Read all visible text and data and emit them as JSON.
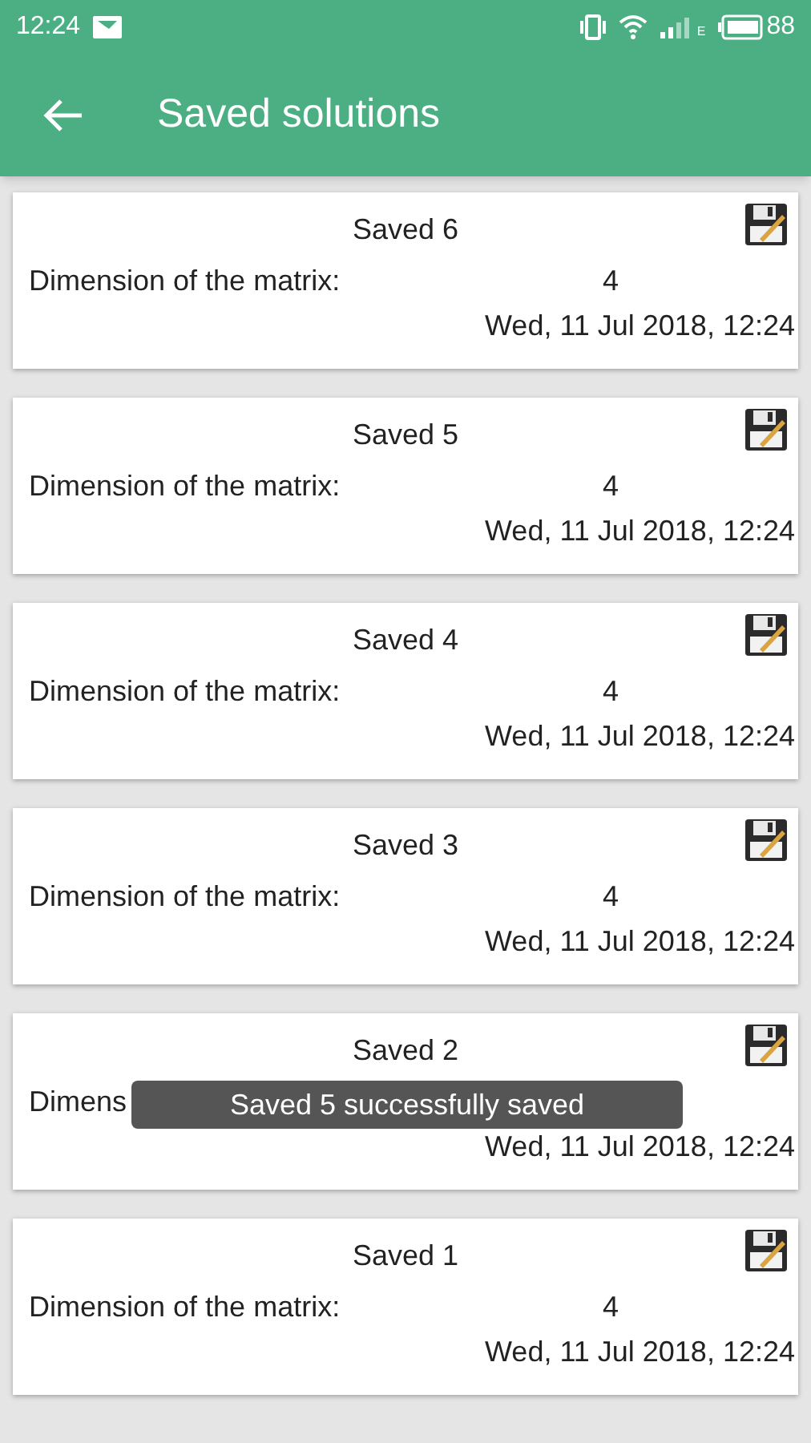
{
  "status_bar": {
    "time": "12:24",
    "network_type": "E",
    "battery": "88"
  },
  "app_bar": {
    "title": "Saved solutions"
  },
  "cards": [
    {
      "title": "Saved 6",
      "label": "Dimension of the matrix:",
      "value": "4",
      "date": "Wed, 11 Jul 2018, 12:24"
    },
    {
      "title": "Saved 5",
      "label": "Dimension of the matrix:",
      "value": "4",
      "date": "Wed, 11 Jul 2018, 12:24"
    },
    {
      "title": "Saved 4",
      "label": "Dimension of the matrix:",
      "value": "4",
      "date": "Wed, 11 Jul 2018, 12:24"
    },
    {
      "title": "Saved 3",
      "label": "Dimension of the matrix:",
      "value": "4",
      "date": "Wed, 11 Jul 2018, 12:24"
    },
    {
      "title": "Saved 2",
      "label": "Dimens",
      "date": "Wed, 11 Jul 2018, 12:24"
    },
    {
      "title": "Saved 1",
      "label": "Dimension of the matrix:",
      "value": "4",
      "date": "Wed, 11 Jul 2018, 12:24"
    }
  ],
  "toast": {
    "text": "Saved 5 successfully saved"
  }
}
